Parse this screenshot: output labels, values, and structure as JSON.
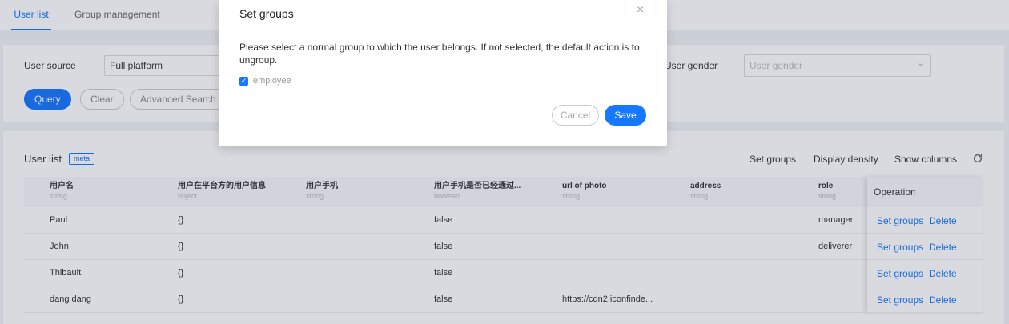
{
  "tabs": [
    {
      "label": "User list",
      "active": true
    },
    {
      "label": "Group management",
      "active": false
    }
  ],
  "filters": {
    "user_source_label": "User source",
    "user_source_value": "Full platform",
    "user_gender_label": "User gender",
    "user_gender_placeholder": "User gender",
    "query": "Query",
    "clear": "Clear",
    "advanced": "Advanced Search"
  },
  "list": {
    "title": "User list",
    "badge": "meta",
    "toolbar": {
      "set_groups": "Set groups",
      "display_density": "Display density",
      "show_columns": "Show columns"
    },
    "columns": [
      {
        "name": "用户名",
        "type": "string"
      },
      {
        "name": "用户在平台方的用户信息",
        "type": "object"
      },
      {
        "name": "用户手机",
        "type": "string"
      },
      {
        "name": "用户手机是否已经通过...",
        "type": "boolean"
      },
      {
        "name": "url of photo",
        "type": "string"
      },
      {
        "name": "address",
        "type": "string"
      },
      {
        "name": "role",
        "type": "string"
      }
    ],
    "operation_header": "Operation",
    "rows": [
      {
        "cells": [
          "Paul",
          "{}",
          "",
          "false",
          "",
          "",
          "manager"
        ]
      },
      {
        "cells": [
          "John",
          "{}",
          "",
          "false",
          "",
          "",
          "deliverer"
        ]
      },
      {
        "cells": [
          "Thibault",
          "{}",
          "",
          "false",
          "",
          "",
          ""
        ]
      },
      {
        "cells": [
          "dang dang",
          "{}",
          "",
          "false",
          "https://cdn2.iconfinde...",
          "",
          ""
        ]
      }
    ],
    "op_set_groups": "Set groups",
    "op_delete": "Delete"
  },
  "modal": {
    "title": "Set groups",
    "body": "Please select a normal group to which the user belongs. If not selected, the default action is to ungroup.",
    "option_label": "employee",
    "option_checked": true,
    "cancel": "Cancel",
    "save": "Save"
  },
  "colors": {
    "accent": "#1677ff",
    "mask": "rgba(40,52,80,0.18)"
  },
  "icons": {
    "close": "close-icon",
    "refresh": "refresh-icon",
    "check": "check-icon",
    "chevron": "chevron-down-icon"
  }
}
